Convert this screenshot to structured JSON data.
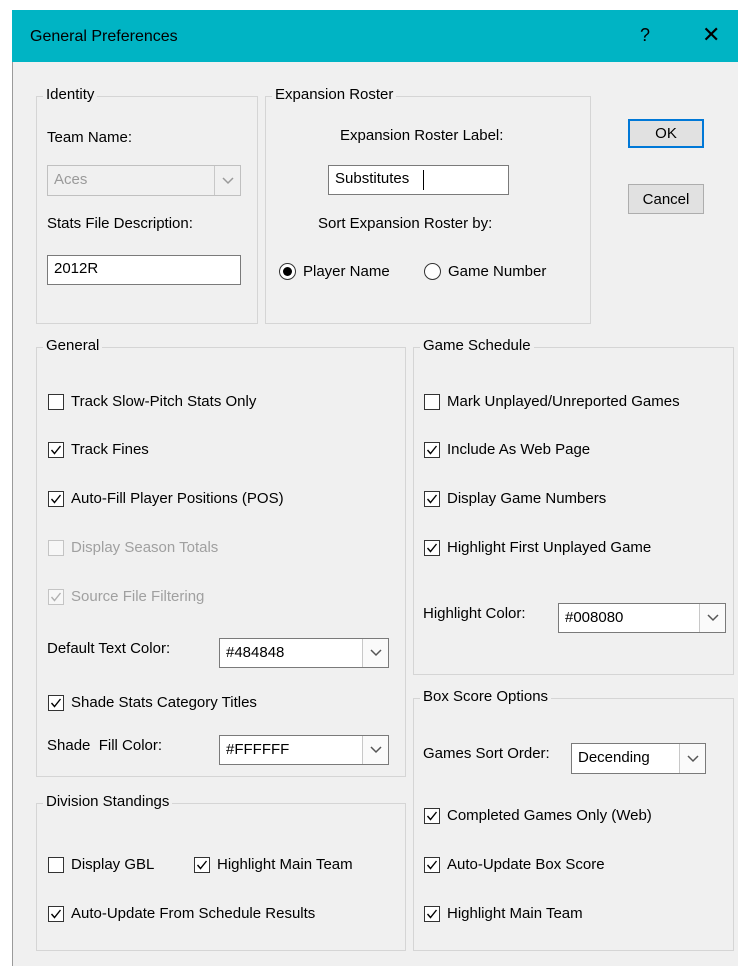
{
  "window": {
    "title": "General Preferences",
    "help_glyph": "?",
    "close_glyph": "✕"
  },
  "identity": {
    "legend": "Identity",
    "team_name_label": "Team Name:",
    "team_name_value": "Aces",
    "stats_desc_label": "Stats File Description:",
    "stats_desc_value": "2012R"
  },
  "expansion": {
    "legend": "Expansion Roster",
    "label_caption": "Expansion Roster Label:",
    "label_value": "Substitutes",
    "sort_caption": "Sort Expansion Roster by:",
    "sort_player_name": "Player Name",
    "sort_game_number": "Game Number",
    "sort_selected": "Player Name"
  },
  "buttons": {
    "ok": "OK",
    "cancel": "Cancel"
  },
  "general": {
    "legend": "General",
    "track_slow_pitch": {
      "label": "Track Slow-Pitch Stats Only",
      "checked": false,
      "enabled": true
    },
    "track_fines": {
      "label": "Track Fines",
      "checked": true,
      "enabled": true
    },
    "auto_fill": {
      "label": "Auto-Fill Player Positions (POS)",
      "checked": true,
      "enabled": true
    },
    "display_season_totals": {
      "label": "Display Season Totals",
      "checked": false,
      "enabled": false
    },
    "source_file_filtering": {
      "label": "Source File Filtering",
      "checked": true,
      "enabled": false
    },
    "default_text_color_label": "Default Text Color:",
    "default_text_color_value": "#484848",
    "shade_titles": {
      "label": "Shade Stats Category Titles",
      "checked": true,
      "enabled": true
    },
    "shade_fill_label": "Shade  Fill Color:",
    "shade_fill_value": "#FFFFFF"
  },
  "division": {
    "legend": "Division Standings",
    "display_gbl": {
      "label": "Display GBL",
      "checked": false
    },
    "highlight_main": {
      "label": "Highlight Main Team",
      "checked": true
    },
    "auto_update": {
      "label": "Auto-Update From Schedule Results",
      "checked": true
    }
  },
  "schedule": {
    "legend": "Game Schedule",
    "mark_unplayed": {
      "label": "Mark Unplayed/Unreported Games",
      "checked": false
    },
    "include_web": {
      "label": "Include As Web Page",
      "checked": true
    },
    "display_numbers": {
      "label": "Display Game Numbers",
      "checked": true
    },
    "highlight_first": {
      "label": "Highlight First Unplayed Game",
      "checked": true
    },
    "highlight_color_label": "Highlight Color:",
    "highlight_color_value": "#008080"
  },
  "boxscore": {
    "legend": "Box Score Options",
    "sort_order_label": "Games Sort Order:",
    "sort_order_value": "Decending",
    "completed_only": {
      "label": "Completed Games Only (Web)",
      "checked": true
    },
    "auto_update": {
      "label": "Auto-Update Box Score",
      "checked": true
    },
    "highlight_main": {
      "label": "Highlight Main Team",
      "checked": true
    }
  },
  "colors": {
    "titlebar": "#00b4c4",
    "dialog_bg": "#f0f0f0",
    "default_button_border": "#0078d7"
  }
}
